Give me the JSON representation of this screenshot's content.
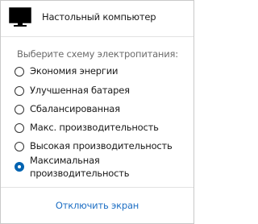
{
  "header": {
    "title": "Настольный компьютер",
    "icon": "desktop-computer-icon"
  },
  "power": {
    "prompt": "Выберите схему электропитания:",
    "options": [
      {
        "label": "Экономия энергии",
        "selected": false
      },
      {
        "label": "Улучшенная батарея",
        "selected": false
      },
      {
        "label": "Сбалансированная",
        "selected": false
      },
      {
        "label": "Макс. производительность",
        "selected": false
      },
      {
        "label": "Высокая производительность",
        "selected": false
      },
      {
        "label": "Максимальная производительность",
        "selected": true
      }
    ]
  },
  "footer": {
    "link_label": "Отключить экран"
  },
  "colors": {
    "accent": "#0063b1",
    "link": "#1e6fc4",
    "muted_text": "#6b6b6b"
  }
}
